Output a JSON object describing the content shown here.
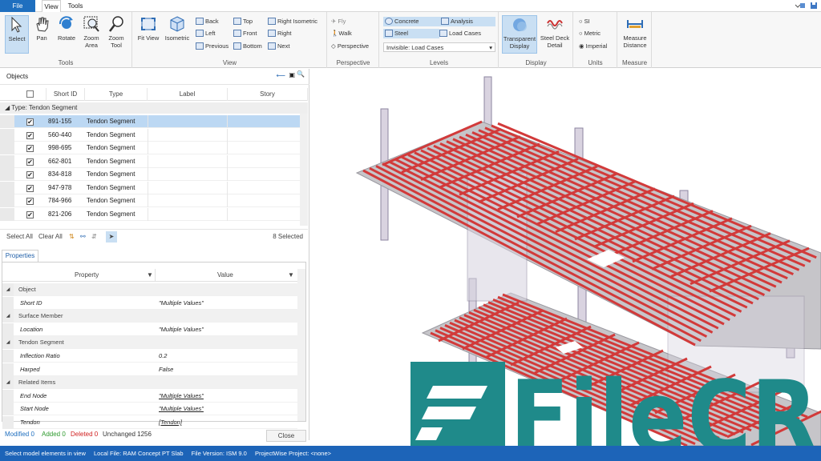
{
  "tabs": {
    "file": "File",
    "view": "View",
    "tools": "Tools"
  },
  "ribbon": {
    "tools": {
      "label": "Tools",
      "select": "Select",
      "pan": "Pan",
      "rotate": "Rotate",
      "zoom_area": "Zoom Area",
      "zoom_tool": "Zoom Tool"
    },
    "view": {
      "label": "View",
      "fit_view": "Fit View",
      "isometric": "Isometric",
      "back": "Back",
      "left": "Left",
      "previous": "Previous",
      "top": "Top",
      "front": "Front",
      "bottom": "Bottom",
      "right_isometric": "Right Isometric",
      "right": "Right",
      "next": "Next"
    },
    "perspective": {
      "label": "Perspective",
      "fly": "Fly",
      "walk": "Walk",
      "perspective": "Perspective"
    },
    "levels": {
      "label": "Levels",
      "concrete": "Concrete",
      "analysis": "Analysis",
      "steel": "Steel",
      "load_cases": "Load Cases",
      "invisible": "Invisible: Load Cases"
    },
    "display": {
      "label": "Display",
      "transparent": "Transparent Display",
      "steel_deck": "Steel Deck Detail"
    },
    "units": {
      "label": "Units",
      "si": "SI",
      "metric": "Metric",
      "imperial": "Imperial",
      "selected": "Imperial"
    },
    "measure": {
      "label": "Measure",
      "distance": "Measure Distance"
    }
  },
  "objects": {
    "title": "Objects",
    "columns": [
      "Short ID",
      "Type",
      "Label",
      "Story"
    ],
    "group": "Type: Tendon Segment",
    "rows": [
      {
        "id": "891-155",
        "type": "Tendon Segment",
        "checked": true,
        "selected": true
      },
      {
        "id": "560-440",
        "type": "Tendon Segment",
        "checked": true
      },
      {
        "id": "998-695",
        "type": "Tendon Segment",
        "checked": true
      },
      {
        "id": "662-801",
        "type": "Tendon Segment",
        "checked": true
      },
      {
        "id": "834-818",
        "type": "Tendon Segment",
        "checked": true
      },
      {
        "id": "947-978",
        "type": "Tendon Segment",
        "checked": true
      },
      {
        "id": "784-966",
        "type": "Tendon Segment",
        "checked": true
      },
      {
        "id": "821-206",
        "type": "Tendon Segment",
        "checked": true
      }
    ],
    "select_all": "Select All",
    "clear_all": "Clear All",
    "selected_count": "8 Selected"
  },
  "properties": {
    "tab": "Properties",
    "col_property": "Property",
    "col_value": "Value",
    "rows": [
      {
        "kind": "cat",
        "name": "Object"
      },
      {
        "kind": "item",
        "name": "Short ID",
        "value": "\"Multiple Values\"",
        "link": false
      },
      {
        "kind": "cat",
        "name": "Surface Member"
      },
      {
        "kind": "item",
        "name": "Location",
        "value": "\"Multiple Values\"",
        "link": false
      },
      {
        "kind": "cat",
        "name": "Tendon Segment"
      },
      {
        "kind": "item",
        "name": "Inflection Ratio",
        "value": "0.2",
        "link": false
      },
      {
        "kind": "item",
        "name": "Harped",
        "value": "False",
        "link": false
      },
      {
        "kind": "cat",
        "name": "Related Items"
      },
      {
        "kind": "item",
        "name": "End Node",
        "value": "\"Multiple Values\"",
        "link": true
      },
      {
        "kind": "item",
        "name": "Start Node",
        "value": "\"Multiple Values\"",
        "link": true
      },
      {
        "kind": "item",
        "name": "Tendon",
        "value": "[Tendon]",
        "link": true
      }
    ]
  },
  "footer": {
    "modified": "Modified 0",
    "added": "Added 0",
    "deleted": "Deleted 0",
    "unchanged": "Unchanged 1256",
    "close": "Close"
  },
  "status": [
    "Select model elements in view",
    "Local File: RAM Concept PT Slab",
    "File Version: ISM 9.0",
    "ProjectWise Project: <none>"
  ],
  "watermark": "FileCR",
  "colors": {
    "accent": "#1f6fbf",
    "status_bar": "#1d64b8",
    "tendon": "#d23a3a",
    "slab": "#b9b9bc",
    "watermark": "#1f8a8a",
    "selected_row": "#bcd8f3",
    "modified": "#1f6fbf",
    "added": "#2e9a2e",
    "deleted": "#d02020"
  }
}
